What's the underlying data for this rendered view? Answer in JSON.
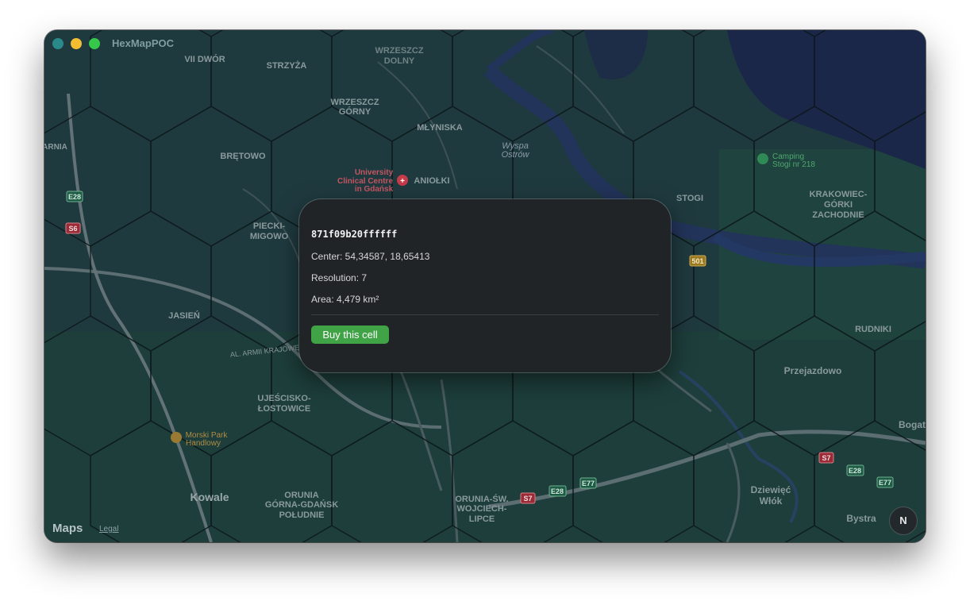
{
  "window": {
    "title": "HexMapPOC"
  },
  "map": {
    "labels": {
      "vii_dwor": "VII DWÓR",
      "strzyza": "STRZYŻA",
      "wrzeszcz_dolny_1": "WRZESZCZ",
      "wrzeszcz_dolny_2": "DOLNY",
      "wrzeszcz_gorny_1": "WRZESZCZ",
      "wrzeszcz_gorny_2": "GÓRNY",
      "mlyniska": "MŁYNISKA",
      "wyspa_1": "Wyspa",
      "wyspa_2": "Ostrów",
      "arnia": "ARNIA",
      "bretowo": "BRĘTOWO",
      "uni_1": "University",
      "uni_2": "Clinical Centre",
      "uni_3": "in Gdańsk",
      "aniolki": "ANIOŁKI",
      "camping_1": "Camping",
      "camping_2": "Stogi nr 218",
      "stogi": "STOGI",
      "krak_1": "KRAKOWIEC-",
      "krak_2": "GÓRKI",
      "krak_3": "ZACHODNIE",
      "piecki_1": "PIECKI-",
      "piecki_2": "MIGOWO",
      "jasien": "JASIEŃ",
      "al_armii": "AL. ARMII KRAJOWEJ",
      "rudniki": "RUDNIKI",
      "przejazdowo": "Przejazdowo",
      "ujescisko_1": "UJEŚCISKO-",
      "ujescisko_2": "ŁOSTOWICE",
      "morski_1": "Morski Park",
      "morski_2": "Handlowy",
      "bogat": "Bogat",
      "kowale": "Kowale",
      "orunia_gorna_1": "ORUNIA",
      "orunia_gorna_2": "GÓRNA-GDAŃSK",
      "orunia_gorna_3": "POŁUDNIE",
      "orunia_sw_1": "ORUNIA-ŚW.",
      "orunia_sw_2": "WOJCIECH-",
      "orunia_sw_3": "LIPCE",
      "dziewiec_1": "Dziewięć",
      "dziewiec_2": "Włók",
      "bystra": "Bystra"
    },
    "shields": {
      "e28_a": "E28",
      "s6": "S6",
      "r501": "501",
      "s7_a": "S7",
      "e28_b": "E28",
      "e77_a": "E77",
      "s7_b": "S7",
      "e28_c": "E28",
      "e77_b": "E77"
    },
    "attribution": {
      "logo": "Maps",
      "legal": "Legal"
    },
    "compass": "N"
  },
  "popup": {
    "cell_id": "871f09b20ffffff",
    "center": "Center: 54,34587, 18,65413",
    "resolution": "Resolution: 7",
    "area": "Area: 4,479 km²",
    "buy_label": "Buy this cell"
  },
  "colors": {
    "map_base": "#1f3a3f",
    "hex_stroke": "#0c1618",
    "water": "#1a2748",
    "button_accent": "#40a346",
    "popup_bg": "#202427"
  }
}
